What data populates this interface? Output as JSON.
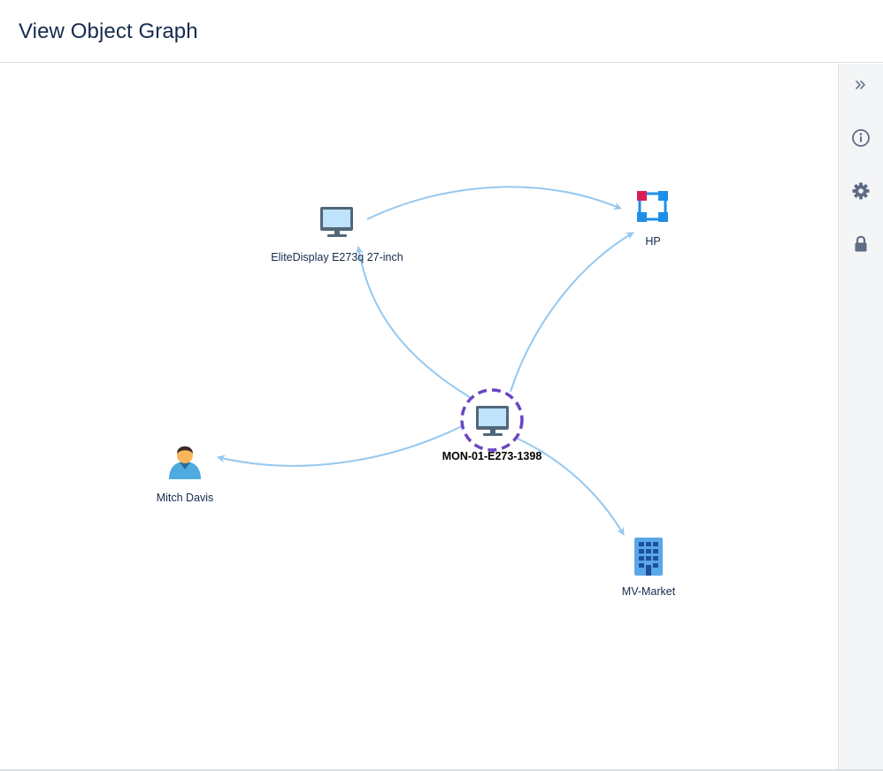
{
  "header": {
    "title": "View Object Graph"
  },
  "graph": {
    "nodes": [
      {
        "id": "center",
        "label": "MON-01-E273-1398",
        "icon": "monitor-icon",
        "selected": true
      },
      {
        "id": "display",
        "label": "EliteDisplay E273q 27-inch",
        "icon": "monitor-icon"
      },
      {
        "id": "hp",
        "label": "HP",
        "icon": "manufacturer-icon"
      },
      {
        "id": "person",
        "label": "Mitch Davis",
        "icon": "person-icon"
      },
      {
        "id": "location",
        "label": "MV-Market",
        "icon": "building-icon"
      }
    ],
    "colors": {
      "edge": "#95c8f0",
      "selection_ring": "#6a45c3",
      "monitor_screen": "#bfe3fb",
      "monitor_frame": "#52677a",
      "hp_red": "#d91e57",
      "hp_blue": "#1e8fe8",
      "building": "#5aa7e8",
      "person_shirt": "#4dabe0",
      "person_skin": "#f7b55a"
    }
  },
  "side_panel": {
    "buttons": [
      {
        "name": "collapse-panel-button",
        "icon": "double-chevron-right-icon"
      },
      {
        "name": "info-button",
        "icon": "info-icon"
      },
      {
        "name": "settings-button",
        "icon": "gear-icon"
      },
      {
        "name": "lock-button",
        "icon": "lock-icon"
      }
    ]
  }
}
